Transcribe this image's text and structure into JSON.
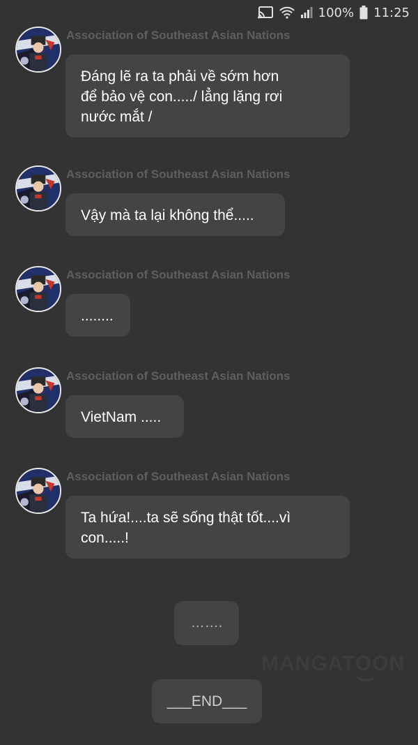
{
  "status_bar": {
    "icons": [
      "cast-icon",
      "wifi-icon",
      "signal-icon",
      "battery-icon"
    ],
    "battery": "100%",
    "time": "11:25"
  },
  "sender_name": "Association of Southeast Asian Nations",
  "messages": [
    {
      "sender": "Association of Southeast Asian Nations",
      "lines": [
        "Đáng lẽ ra ta phải về sớm hơn",
        "để bảo vệ con...../ lẳng lặng rơi",
        "nước mắt /"
      ]
    },
    {
      "sender": "Association of Southeast Asian Nations",
      "lines": [
        "Vậy mà ta lại không thể....."
      ]
    },
    {
      "sender": "Association of Southeast Asian Nations",
      "lines": [
        "........"
      ]
    },
    {
      "sender": "Association of Southeast Asian Nations",
      "lines": [
        "VietNam ....."
      ]
    },
    {
      "sender": "Association of Southeast Asian Nations",
      "lines": [
        "Ta hứa!....ta sẽ sống thật tốt....vì",
        "con.....!"
      ]
    }
  ],
  "narration": "…….",
  "end_label": "___END___",
  "watermark": "MANGATOON",
  "colors": {
    "background": "#333333",
    "bubble": "#444444",
    "sender_text": "#5f5f5f"
  }
}
